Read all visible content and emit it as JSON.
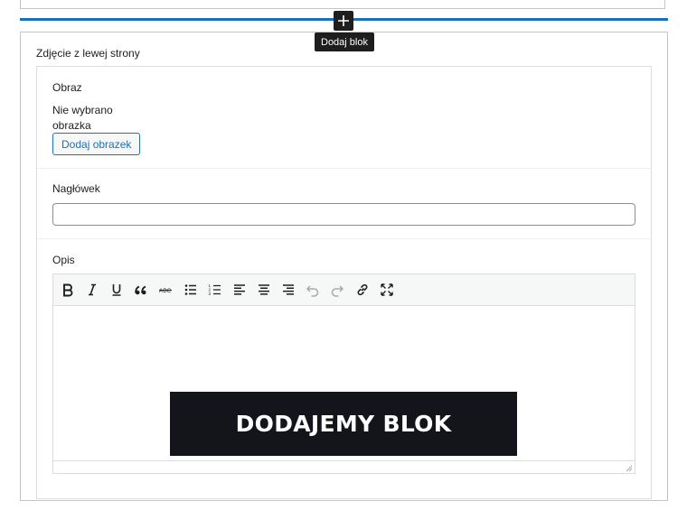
{
  "inserter": {
    "tooltip": "Dodaj blok",
    "icon": "plus-icon"
  },
  "block": {
    "title": "Zdjęcie z lewej strony",
    "fields": {
      "image": {
        "label": "Obraz",
        "empty_text": "Nie wybrano obrazka",
        "button_label": "Dodaj obrazek"
      },
      "heading": {
        "label": "Nagłówek",
        "value": ""
      },
      "description": {
        "label": "Opis",
        "toolbar": [
          {
            "name": "bold-icon"
          },
          {
            "name": "italic-icon"
          },
          {
            "name": "underline-icon"
          },
          {
            "name": "blockquote-icon"
          },
          {
            "name": "strikethrough-icon"
          },
          {
            "name": "bulleted-list-icon"
          },
          {
            "name": "numbered-list-icon"
          },
          {
            "name": "align-left-icon"
          },
          {
            "name": "align-center-icon"
          },
          {
            "name": "align-right-icon"
          },
          {
            "name": "undo-icon"
          },
          {
            "name": "redo-icon"
          },
          {
            "name": "link-icon"
          },
          {
            "name": "fullscreen-icon"
          }
        ]
      }
    }
  },
  "banner": {
    "text": "DODAJEMY BLOK"
  },
  "colors": {
    "accent": "#1b6fb8",
    "button_blue": "#2271b1",
    "banner_bg": "#14151b"
  }
}
